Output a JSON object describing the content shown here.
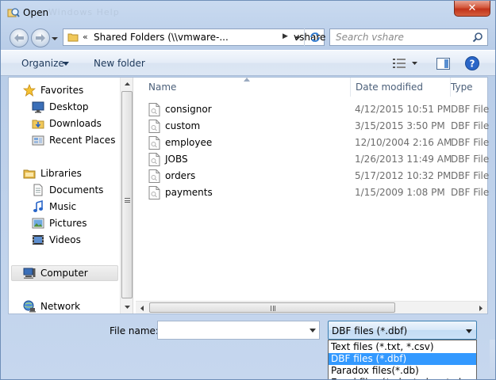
{
  "window": {
    "title": "Open",
    "title_ghost": "Windows Help"
  },
  "address": {
    "chevron": "«",
    "path": "Shared Folders (\\\\vmware-...",
    "current": "vshare"
  },
  "search": {
    "placeholder": "Search vshare"
  },
  "toolbar": {
    "organize_label": "Organize",
    "new_folder_label": "New folder"
  },
  "navpane": {
    "items": [
      {
        "label": "Favorites",
        "icon": "star-icon",
        "level": "top"
      },
      {
        "label": "Desktop",
        "icon": "desktop-icon",
        "level": "sub"
      },
      {
        "label": "Downloads",
        "icon": "downloads-icon",
        "level": "sub"
      },
      {
        "label": "Recent Places",
        "icon": "recent-places-icon",
        "level": "sub"
      },
      {
        "label": "Libraries",
        "icon": "libraries-icon",
        "level": "top"
      },
      {
        "label": "Documents",
        "icon": "documents-icon",
        "level": "sub"
      },
      {
        "label": "Music",
        "icon": "music-icon",
        "level": "sub"
      },
      {
        "label": "Pictures",
        "icon": "pictures-icon",
        "level": "sub"
      },
      {
        "label": "Videos",
        "icon": "videos-icon",
        "level": "sub"
      },
      {
        "label": "Computer",
        "icon": "computer-icon",
        "level": "top",
        "selected": true
      },
      {
        "label": "Network",
        "icon": "network-icon",
        "level": "top"
      }
    ]
  },
  "filelist": {
    "columns": [
      "Name",
      "Date modified",
      "Type"
    ],
    "files": [
      {
        "name": "consignor",
        "date": "4/12/2015 10:51 PM",
        "type": "DBF File"
      },
      {
        "name": "custom",
        "date": "3/15/2015 3:50 PM",
        "type": "DBF File"
      },
      {
        "name": "employee",
        "date": "12/10/2004 2:16 AM",
        "type": "DBF File"
      },
      {
        "name": "JOBS",
        "date": "1/26/2013 11:49 AM",
        "type": "DBF File"
      },
      {
        "name": "orders",
        "date": "5/17/2012 10:32 PM",
        "type": "DBF File"
      },
      {
        "name": "payments",
        "date": "1/15/2009 1:08 PM",
        "type": "DBF File"
      }
    ]
  },
  "bottom": {
    "file_name_label": "File name:",
    "file_name_value": "",
    "file_type_selected": "DBF files (*.dbf)",
    "file_type_options": [
      "Text files (*.txt, *.csv)",
      "DBF files (*.dbf)",
      "Paradox files(*.db)",
      "Excel files (*.xls, *.xlsx, *.xlsm)"
    ],
    "file_type_selected_index": 1
  },
  "colors": {
    "selection": "#3399ff",
    "link_text": "#1e395b",
    "close_button": "#c1331a"
  }
}
